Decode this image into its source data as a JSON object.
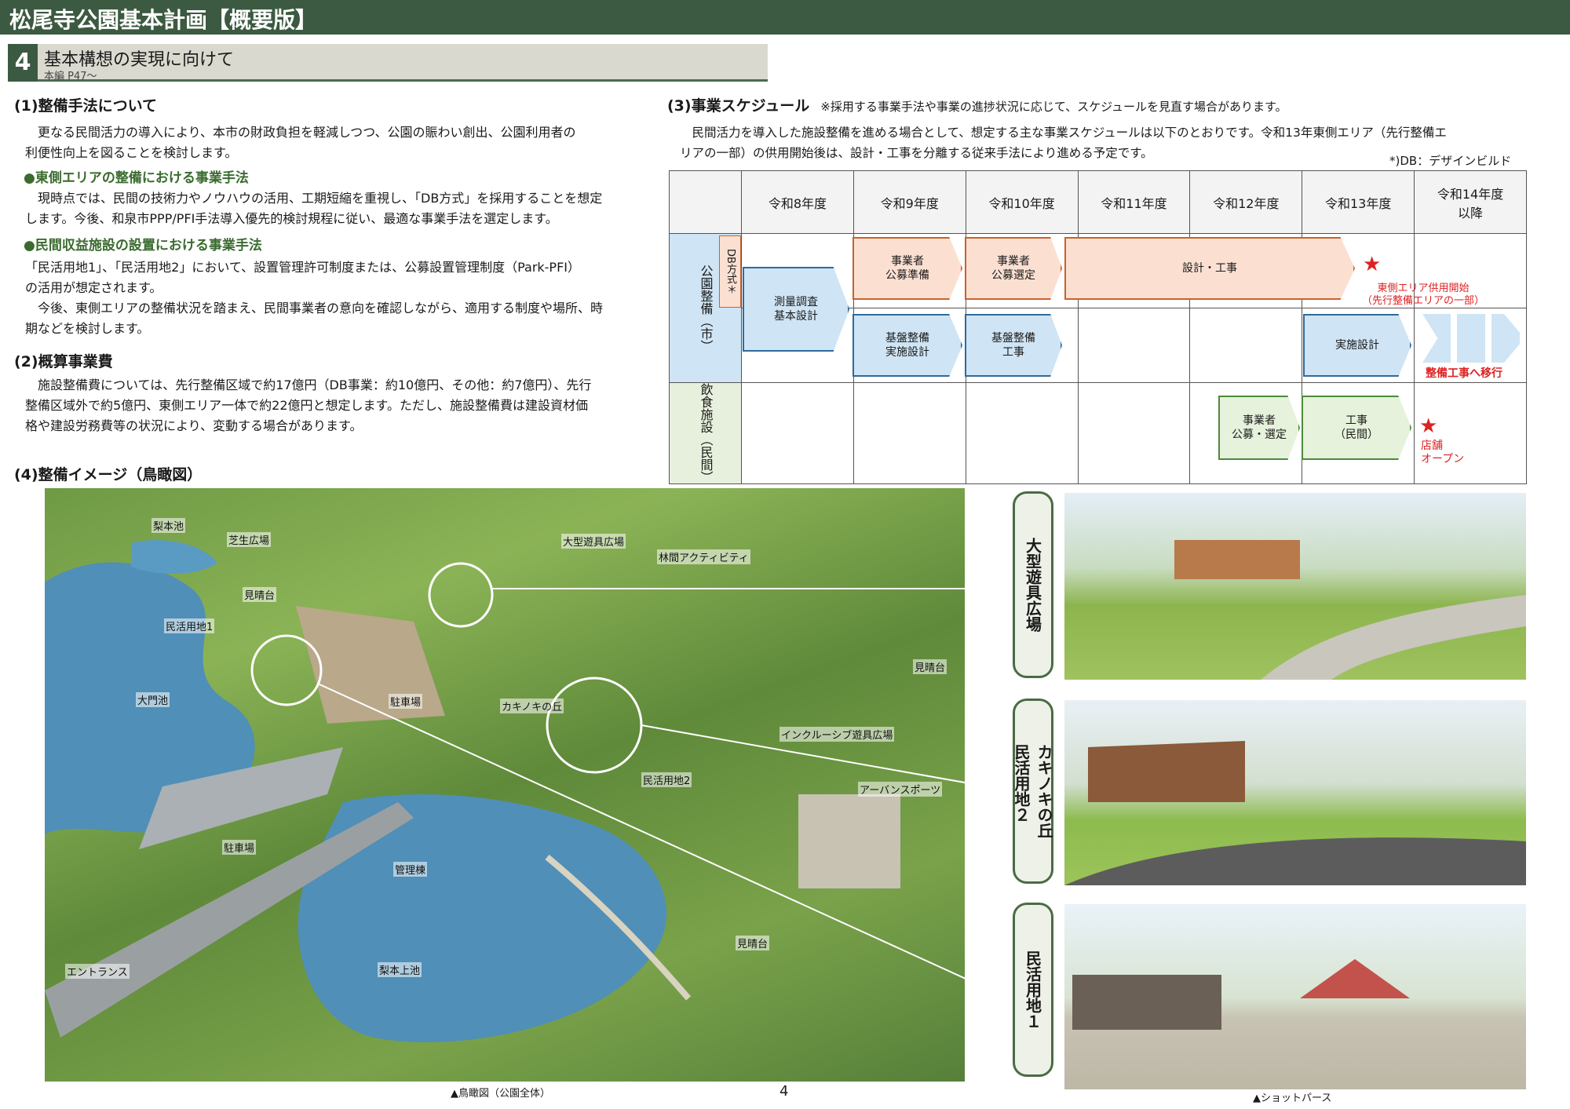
{
  "header": {
    "title": "松尾寺公園基本計画【概要版】"
  },
  "section": {
    "num": "4",
    "title": "基本構想の実現に向けて",
    "sub": "本編 P47～"
  },
  "s1": {
    "title": "(1)整備手法について",
    "p1a": "　更なる民間活力の導入により、本市の財政負担を軽減しつつ、公園の賑わい創出、公園利用者の",
    "p1b": "利便性向上を図ることを検討します。",
    "h_east": "●東側エリアの整備における事業手法",
    "p2a": "　現時点では、民間の技術力やノウハウの活用、工期短縮を重視し、「DB方式」を採用することを想定",
    "p2b": "します。今後、和泉市PPP/PFI手法導入優先的検討規程に従い、最適な事業手法を選定します。",
    "h_private": "●民間収益施設の設置における事業手法",
    "p3a": "「民活用地1」、「民活用地2」において、設置管理許可制度または、公募設置管理制度（Park-PFI）",
    "p3b": "の活用が想定されます。",
    "p3c": "　今後、東側エリアの整備状況を踏まえ、民間事業者の意向を確認しながら、適用する制度や場所、時",
    "p3d": "期などを検討します。"
  },
  "s2": {
    "title": "(2)概算事業費",
    "p1": "　施設整備費については、先行整備区域で約17億円（DB事業：約10億円、その他：約7億円）、先行",
    "p2": "整備区域外で約5億円、東側エリア一体で約22億円と想定します。ただし、施設整備費は建設資材価",
    "p3": "格や建設労務費等の状況により、変動する場合があります。"
  },
  "s3": {
    "title": "(3)事業スケジュール",
    "note": "※採用する事業手法や事業の進捗状況に応じて、スケジュールを見直す場合があります。",
    "p1": "　民間活力を導入した施設整備を進める場合として、想定する主な事業スケジュールは以下のとおりです。令和13年東側エリア（先行整備エ",
    "p2": "リアの一部）の供用開始後は、設計・工事を分離する従来手法により進める予定です。",
    "db_note": "*)DB：デザインビルド",
    "years": [
      "令和8年度",
      "令和9年度",
      "令和10年度",
      "令和11年度",
      "令和12年度",
      "令和13年度",
      "令和14年度\n以降"
    ],
    "row1": "公園整備（市）",
    "row2": "飲食施設（民間）",
    "db_label": "DB方式＊",
    "bars": {
      "survey": "測量調査\n基本設計",
      "recruit_prep": "事業者\n公募準備",
      "select": "事業者\n公募選定",
      "design_build": "設計・工事",
      "base_design": "基盤整備\n実施設計",
      "base_work": "基盤整備\n工事",
      "impl_design": "実施設計",
      "f_recruit": "事業者\n公募・選定",
      "f_work": "工事\n（民間）"
    },
    "red1": "東側エリア供用開始\n（先行整備エリアの一部）",
    "red2": "整備工事へ移行",
    "red3": "店舗\nオープン"
  },
  "s4": {
    "title": "(4)整備イメージ（鳥瞰図）",
    "labels": [
      "梨本池",
      "芝生広場",
      "大型遊具広場",
      "林間アクティビティ",
      "見晴台",
      "民活用地1",
      "大門池",
      "駐車場",
      "カキノキの丘",
      "見晴台",
      "インクルーシブ遊具広場",
      "民活用地2",
      "アーバンスポーツ",
      "駐車場",
      "管理棟",
      "見晴台",
      "エントランス",
      "梨本上池"
    ],
    "tabs": [
      "大型遊具広場",
      "カキノキの丘\n民活用地２",
      "民活用地１"
    ],
    "cap_map": "▲鳥瞰図（公園全体）",
    "cap_shot": "▲ショットパース",
    "page": "4"
  }
}
